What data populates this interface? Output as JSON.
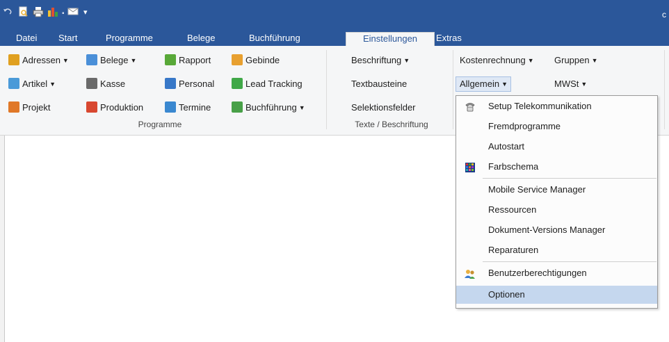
{
  "quick_access": {
    "icons": [
      "undo-icon",
      "print-preview-icon",
      "print-icon",
      "chart-icon",
      "email-icon",
      "customize-icon"
    ]
  },
  "title_right": "c",
  "tabs": [
    {
      "label": "Datei"
    },
    {
      "label": "Start"
    },
    {
      "label": "Programme"
    },
    {
      "label": "Belege"
    },
    {
      "label": "Buchführung"
    },
    {
      "label": "Einstellungen",
      "active": true
    },
    {
      "label": "Extras"
    }
  ],
  "ribbon": {
    "programme": {
      "items": {
        "adressen": "Adressen",
        "belege": "Belege",
        "rapport": "Rapport",
        "gebinde": "Gebinde",
        "artikel": "Artikel",
        "kasse": "Kasse",
        "personal": "Personal",
        "lead_tracking": "Lead Tracking",
        "projekt": "Projekt",
        "produktion": "Produktion",
        "termine": "Termine",
        "buchfuehrung": "Buchführung"
      },
      "group_label": "Programme"
    },
    "texte": {
      "beschriftung": "Beschriftung",
      "textbausteine": "Textbausteine",
      "selektionsfelder": "Selektionsfelder",
      "group_label": "Texte / Beschriftung"
    },
    "setup": {
      "kostenrechnung": "Kostenrechnung",
      "gruppen": "Gruppen",
      "allgemein": "Allgemein",
      "mwst": "MWSt"
    }
  },
  "menu": {
    "items": [
      {
        "label": "Setup Telekommunikation",
        "icon": "phone-icon"
      },
      {
        "label": "Fremdprogramme"
      },
      {
        "label": "Autostart"
      },
      {
        "label": "Farbschema",
        "icon": "color-grid-icon"
      },
      {
        "label": "Mobile Service Manager"
      },
      {
        "label": "Ressourcen"
      },
      {
        "label": "Dokument-Versions Manager"
      },
      {
        "label": "Reparaturen"
      },
      {
        "label": "Benutzerberechtigungen",
        "icon": "users-icon"
      },
      {
        "label": "Optionen",
        "highlighted": true
      }
    ]
  },
  "colors": {
    "titlebar": "#2b579a",
    "menu_highlight": "#c5d7ee"
  }
}
